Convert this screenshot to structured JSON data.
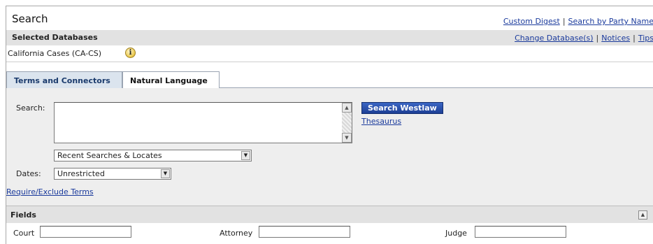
{
  "header": {
    "title": "Search",
    "links": [
      "Custom Digest",
      "Search by Party Name"
    ],
    "separator": "|"
  },
  "databases": {
    "title": "Selected Databases",
    "links": [
      "Change Database(s)",
      "Notices",
      "Tips"
    ],
    "selected": "California Cases (CA-CS)",
    "info_icon": "info-icon"
  },
  "tabs": [
    {
      "label": "Terms and Connectors",
      "active": false
    },
    {
      "label": "Natural Language",
      "active": true
    }
  ],
  "search": {
    "label": "Search:",
    "value": "",
    "submit_label": "Search Westlaw",
    "thesaurus_label": "Thesaurus",
    "recent_select": "Recent Searches & Locates",
    "dates_label": "Dates:",
    "dates_select": "Unrestricted",
    "require_exclude_label": "Require/Exclude Terms"
  },
  "fields": {
    "title": "Fields",
    "items": [
      {
        "label": "Court",
        "value": ""
      },
      {
        "label": "Attorney",
        "value": ""
      },
      {
        "label": "Judge",
        "value": ""
      }
    ]
  },
  "colors": {
    "accent": "#1d3f95",
    "link": "#1a3a9c",
    "panel_bg": "#eeeeee",
    "bar_bg": "#e2e2e2"
  }
}
